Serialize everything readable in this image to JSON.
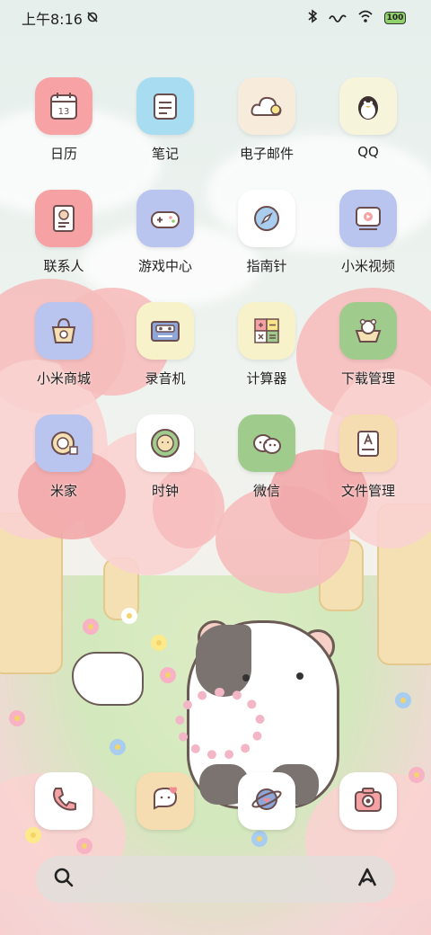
{
  "status_bar": {
    "time": "上午8:16",
    "alarm_icon": "alarm-off-icon",
    "bluetooth_icon": "bluetooth-icon",
    "signal_icon": "signal-icon",
    "wifi_icon": "wifi-icon",
    "battery_level": "100"
  },
  "apps": [
    {
      "label": "日历",
      "icon": "calendar-icon",
      "calendar_day": "13",
      "bg": "#f7a3a6"
    },
    {
      "label": "笔记",
      "icon": "notes-icon",
      "bg": "#a8dcf0"
    },
    {
      "label": "电子邮件",
      "icon": "email-cloud-icon",
      "bg": "#f7ecdc"
    },
    {
      "label": "QQ",
      "icon": "qq-penguin-icon",
      "bg": "#f6f4da"
    },
    {
      "label": "联系人",
      "icon": "contacts-icon",
      "bg": "#f6a1a4"
    },
    {
      "label": "游戏中心",
      "icon": "gamepad-icon",
      "bg": "#b9c4ef"
    },
    {
      "label": "指南针",
      "icon": "compass-icon",
      "bg": "#ffffff"
    },
    {
      "label": "小米视频",
      "icon": "video-icon",
      "bg": "#b9c4ef"
    },
    {
      "label": "小米商城",
      "icon": "shopping-bag-icon",
      "bg": "#b9c4ef"
    },
    {
      "label": "录音机",
      "icon": "cassette-icon",
      "bg": "#f7f2c9"
    },
    {
      "label": "计算器",
      "icon": "calculator-icon",
      "bg": "#f7f2c9"
    },
    {
      "label": "下载管理",
      "icon": "download-bear-icon",
      "bg": "#9fcb8c"
    },
    {
      "label": "米家",
      "icon": "mijia-tape-icon",
      "bg": "#b9c4ef"
    },
    {
      "label": "时钟",
      "icon": "clock-icon",
      "bg": "#ffffff"
    },
    {
      "label": "微信",
      "icon": "wechat-icon",
      "bg": "#9fcb8c"
    },
    {
      "label": "文件管理",
      "icon": "file-manager-icon",
      "bg": "#f6ddb1"
    }
  ],
  "dock": [
    {
      "icon": "phone-icon",
      "bg": "#ffffff"
    },
    {
      "icon": "messages-icon",
      "bg": "#f6ddb1"
    },
    {
      "icon": "browser-planet-icon",
      "bg": "#ffffff"
    },
    {
      "icon": "camera-icon",
      "bg": "#ffffff"
    }
  ],
  "search_bar": {
    "search_icon": "search-icon",
    "assistant_icon": "assistant-icon"
  }
}
